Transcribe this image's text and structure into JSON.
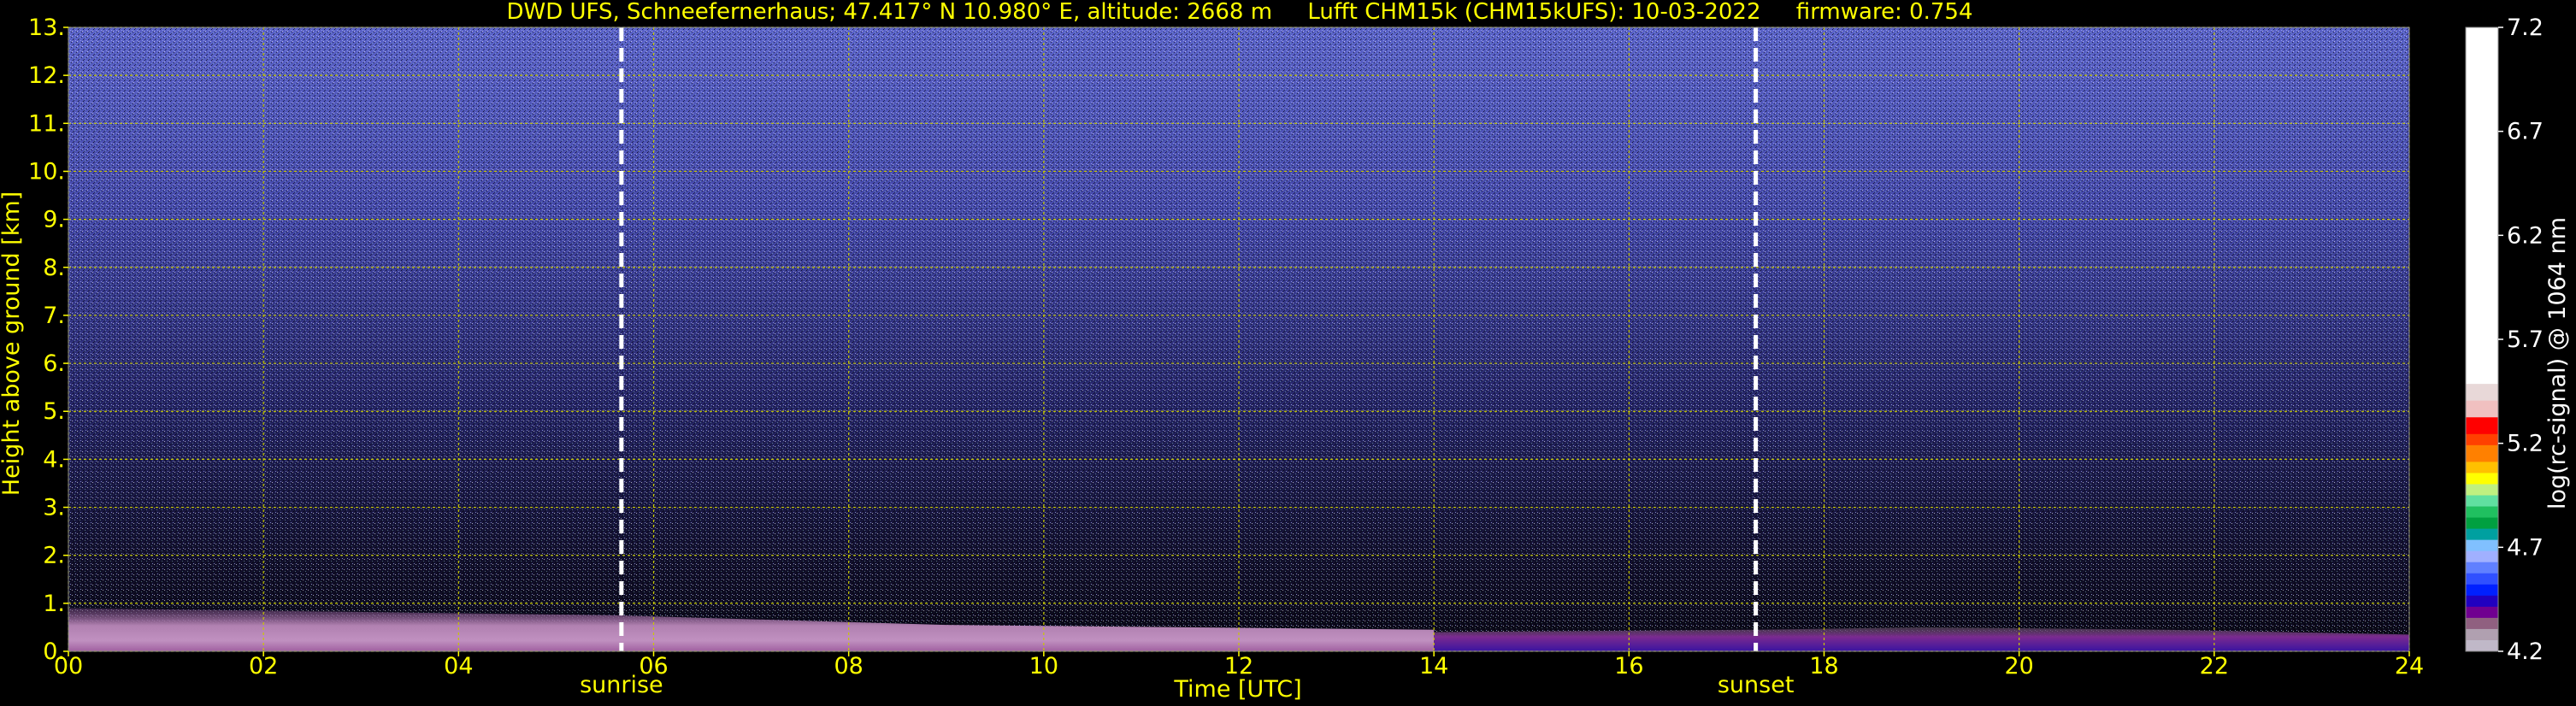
{
  "chart_data": {
    "type": "heatmap",
    "title": "DWD UFS, Schneefernerhaus; 47.417° N 10.980° E, altitude: 2668 m     Lufft CHM15k (CHM15kUFS): 10-03-2022     firmware: 0.754",
    "xlabel": "Time [UTC]",
    "ylabel": "Height above ground [km]",
    "xlim": [
      0,
      24
    ],
    "ylim": [
      0,
      13
    ],
    "x_tick_labels": [
      "00",
      "02",
      "04",
      "06",
      "08",
      "10",
      "12",
      "14",
      "16",
      "18",
      "20",
      "22",
      "24"
    ],
    "y_tick_labels": [
      "0.",
      "1.",
      "2.",
      "3.",
      "4.",
      "5.",
      "6.",
      "7.",
      "8.",
      "9.",
      "10.",
      "11.",
      "12.",
      "13."
    ],
    "grid": true,
    "annotations": [
      {
        "text": "sunrise",
        "x": 5.67
      },
      {
        "text": "sunset",
        "x": 17.3
      }
    ],
    "colorbar": {
      "label": "log(rc-signal) @ 1064 nm",
      "range": [
        4.2,
        7.2
      ],
      "tick_labels": [
        "4.2",
        "4.7",
        "5.2",
        "5.7",
        "6.2",
        "6.7",
        "7.2"
      ]
    },
    "features": [
      {
        "desc": "aerosol layer (pink)",
        "x": [
          0,
          14
        ],
        "height_km": [
          0,
          0.9
        ]
      },
      {
        "desc": "aerosol layer (purple)",
        "x": [
          14,
          24
        ],
        "height_km": [
          0,
          0.5
        ]
      }
    ]
  },
  "colors": {
    "text": "#ffff00",
    "grid": "#c8c800",
    "background": "#000000",
    "markers": "#ffffff"
  }
}
